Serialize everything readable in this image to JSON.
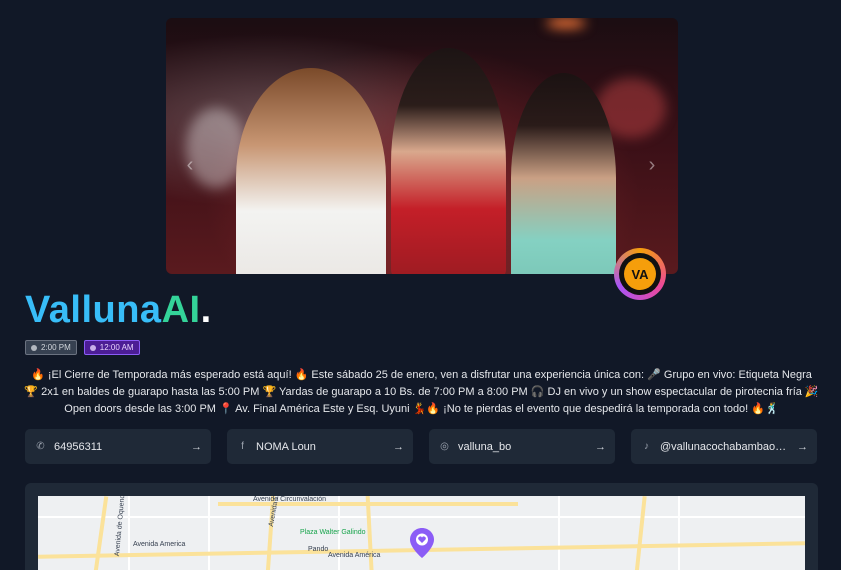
{
  "hero": {
    "image_alt": "event photo",
    "prev_icon": "chevron-left-icon",
    "next_icon": "chevron-right-icon"
  },
  "logo_badge": {
    "text": "VA"
  },
  "brand": {
    "part1": "Valluna",
    "part2": "AI",
    "part3": "."
  },
  "times": {
    "start": "2:00 PM",
    "end": "12:00 AM"
  },
  "description": "🔥 ¡El Cierre de Temporada más esperado está aquí! 🔥 Este sábado 25 de enero, ven a disfrutar una experiencia única con: 🎤 Grupo en vivo: Etiqueta Negra 🏆 2x1 en baldes de guarapo hasta las 5:00 PM 🏆 Yardas de guarapo a 10 Bs. de 7:00 PM a 8:00 PM 🎧 DJ en vivo y un show espectacular de pirotecnia fría 🎉 Open doors desde las 3:00 PM 📍 Av. Final América Este y Esq. Uyuni 💃🔥 ¡No te pierdas el evento que despedirá la temporada con todo! 🔥🕺",
  "links": [
    {
      "icon": "whatsapp-icon",
      "glyph": "✆",
      "text": "64956311"
    },
    {
      "icon": "facebook-icon",
      "glyph": "f",
      "text": "NOMA Loun"
    },
    {
      "icon": "instagram-icon",
      "glyph": "◎",
      "text": "valluna_bo"
    },
    {
      "icon": "tiktok-icon",
      "glyph": "♪",
      "text": "@vallunacochabambaofic..."
    }
  ],
  "link_arrow": "→",
  "map": {
    "labels": {
      "circunvalacion": "Avenida Circunvalación",
      "america_left": "Avenida America",
      "america_mid": "Avenida América",
      "plaza": "Plaza Walter Galindo",
      "libertador": "Avenida Libertador Simón",
      "pando": "Pando",
      "oquendo": "Avenida de Oquendo"
    }
  },
  "colors": {
    "accent_purple": "#8b5cf6",
    "brand_blue": "#38bdf8",
    "brand_green": "#34d399"
  }
}
